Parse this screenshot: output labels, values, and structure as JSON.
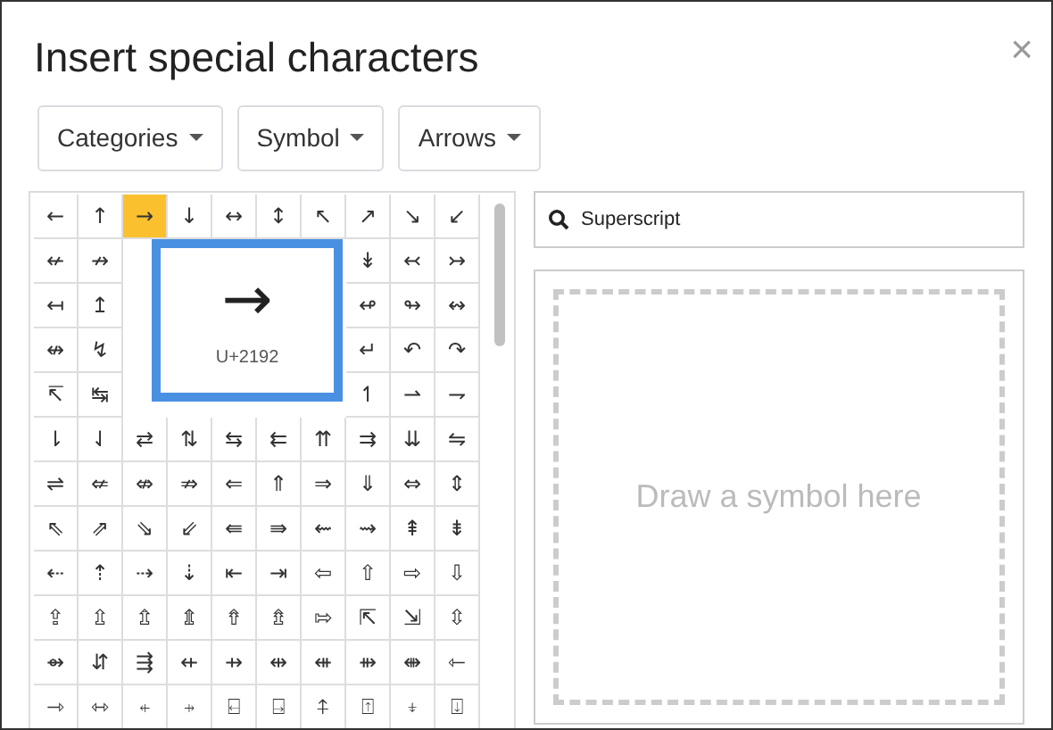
{
  "dialog": {
    "title": "Insert special characters",
    "close": "×"
  },
  "dropdowns": [
    {
      "label": "Categories"
    },
    {
      "label": "Symbol"
    },
    {
      "label": "Arrows"
    }
  ],
  "grid": {
    "rows": [
      [
        {
          "char": "←",
          "selected": false
        },
        {
          "char": "↑",
          "selected": false
        },
        {
          "char": "→",
          "selected": true
        },
        {
          "char": "↓",
          "selected": false
        },
        {
          "char": "↔",
          "selected": false
        },
        {
          "char": "↕",
          "selected": false
        },
        {
          "char": "↖",
          "selected": false
        },
        {
          "char": "↗",
          "selected": false
        },
        {
          "char": "↘",
          "selected": false
        },
        {
          "char": "↙",
          "selected": false
        }
      ],
      [
        {
          "char": "↚",
          "selected": false
        },
        {
          "char": "↛",
          "selected": false
        },
        null,
        null,
        null,
        null,
        null,
        {
          "char": "↡",
          "selected": false
        },
        {
          "char": "↢",
          "selected": false
        },
        {
          "char": "↣",
          "selected": false
        }
      ],
      [
        {
          "char": "↤",
          "selected": false
        },
        {
          "char": "↥",
          "selected": false
        },
        null,
        null,
        null,
        null,
        null,
        {
          "char": "↫",
          "selected": false
        },
        {
          "char": "↬",
          "selected": false
        },
        {
          "char": "↭",
          "selected": false
        }
      ],
      [
        {
          "char": "↮",
          "selected": false
        },
        {
          "char": "↯",
          "selected": false
        },
        null,
        null,
        null,
        null,
        null,
        {
          "char": "↵",
          "selected": false
        },
        {
          "char": "↶",
          "selected": false
        },
        {
          "char": "↷",
          "selected": false
        }
      ],
      [
        {
          "char": "↸",
          "selected": false
        },
        {
          "char": "↹",
          "selected": false
        },
        null,
        null,
        null,
        null,
        null,
        {
          "char": "↿",
          "selected": false
        },
        {
          "char": "⇀",
          "selected": false
        },
        {
          "char": "⇁",
          "selected": false
        }
      ],
      [
        {
          "char": "⇂",
          "selected": false
        },
        {
          "char": "⇃",
          "selected": false
        },
        {
          "char": "⇄",
          "selected": false
        },
        {
          "char": "⇅",
          "selected": false
        },
        {
          "char": "⇆",
          "selected": false
        },
        {
          "char": "⇇",
          "selected": false
        },
        {
          "char": "⇈",
          "selected": false
        },
        {
          "char": "⇉",
          "selected": false
        },
        {
          "char": "⇊",
          "selected": false
        },
        {
          "char": "⇋",
          "selected": false
        }
      ],
      [
        {
          "char": "⇌",
          "selected": false
        },
        {
          "char": "⇍",
          "selected": false
        },
        {
          "char": "⇎",
          "selected": false
        },
        {
          "char": "⇏",
          "selected": false
        },
        {
          "char": "⇐",
          "selected": false
        },
        {
          "char": "⇑",
          "selected": false
        },
        {
          "char": "⇒",
          "selected": false
        },
        {
          "char": "⇓",
          "selected": false
        },
        {
          "char": "⇔",
          "selected": false
        },
        {
          "char": "⇕",
          "selected": false
        }
      ],
      [
        {
          "char": "⇖",
          "selected": false
        },
        {
          "char": "⇗",
          "selected": false
        },
        {
          "char": "⇘",
          "selected": false
        },
        {
          "char": "⇙",
          "selected": false
        },
        {
          "char": "⇚",
          "selected": false
        },
        {
          "char": "⇛",
          "selected": false
        },
        {
          "char": "⇜",
          "selected": false
        },
        {
          "char": "⇝",
          "selected": false
        },
        {
          "char": "⇞",
          "selected": false
        },
        {
          "char": "⇟",
          "selected": false
        }
      ],
      [
        {
          "char": "⇠",
          "selected": false
        },
        {
          "char": "⇡",
          "selected": false
        },
        {
          "char": "⇢",
          "selected": false
        },
        {
          "char": "⇣",
          "selected": false
        },
        {
          "char": "⇤",
          "selected": false
        },
        {
          "char": "⇥",
          "selected": false
        },
        {
          "char": "⇦",
          "selected": false
        },
        {
          "char": "⇧",
          "selected": false
        },
        {
          "char": "⇨",
          "selected": false
        },
        {
          "char": "⇩",
          "selected": false
        }
      ],
      [
        {
          "char": "⇪",
          "selected": false
        },
        {
          "char": "⇫",
          "selected": false
        },
        {
          "char": "⇬",
          "selected": false
        },
        {
          "char": "⇭",
          "selected": false
        },
        {
          "char": "⇮",
          "selected": false
        },
        {
          "char": "⇯",
          "selected": false
        },
        {
          "char": "⇰",
          "selected": false
        },
        {
          "char": "⇱",
          "selected": false
        },
        {
          "char": "⇲",
          "selected": false
        },
        {
          "char": "⇳",
          "selected": false
        }
      ],
      [
        {
          "char": "⇴",
          "selected": false
        },
        {
          "char": "⇵",
          "selected": false
        },
        {
          "char": "⇶",
          "selected": false
        },
        {
          "char": "⇷",
          "selected": false
        },
        {
          "char": "⇸",
          "selected": false
        },
        {
          "char": "⇹",
          "selected": false
        },
        {
          "char": "⇺",
          "selected": false
        },
        {
          "char": "⇻",
          "selected": false
        },
        {
          "char": "⇼",
          "selected": false
        },
        {
          "char": "⇽",
          "selected": false
        }
      ],
      [
        {
          "char": "⇾",
          "selected": false
        },
        {
          "char": "⇿",
          "selected": false
        },
        {
          "char": "⍅",
          "selected": false
        },
        {
          "char": "⍆",
          "selected": false
        },
        {
          "char": "⍇",
          "selected": false
        },
        {
          "char": "⍈",
          "selected": false
        },
        {
          "char": "⍏",
          "selected": false
        },
        {
          "char": "⍐",
          "selected": false
        },
        {
          "char": "⍖",
          "selected": false
        },
        {
          "char": "⍗",
          "selected": false
        }
      ]
    ]
  },
  "preview": {
    "char": "→",
    "code": "U+2192"
  },
  "search": {
    "value": "Superscript"
  },
  "draw_area": {
    "placeholder": "Draw a symbol here"
  }
}
